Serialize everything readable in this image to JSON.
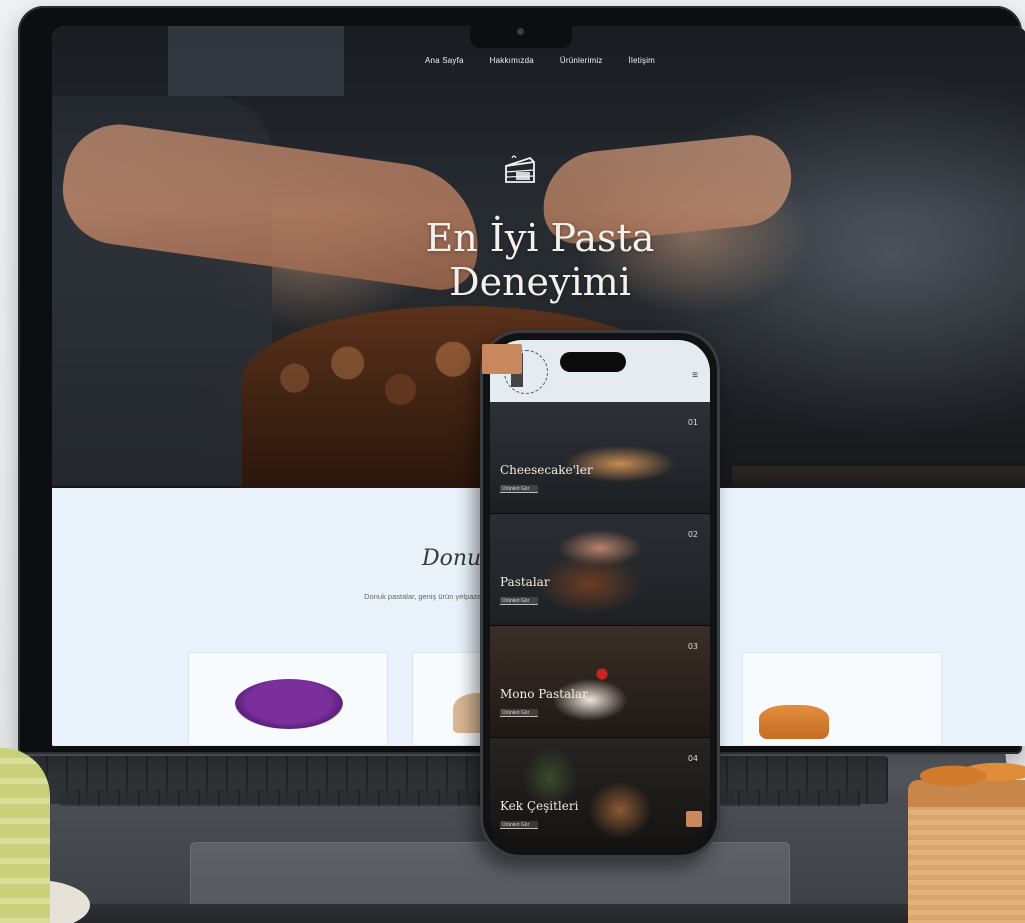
{
  "laptop_site": {
    "nav": [
      "Ana Sayfa",
      "Hakkımızda",
      "Ürünlerimiz",
      "İletişim"
    ],
    "hero_title_line1": "En İyi Pasta",
    "hero_title_line2": "Deneyimi",
    "about_title": "Donukla T",
    "about_text": "Donuk pastalar, geniş ürün yelpazesi. İs... memnuniyetini amaç ve özenle, kalit..."
  },
  "phone_site": {
    "categories": [
      {
        "num": "01",
        "title": "Cheesecake'ler",
        "button": "Ürünleri Gör"
      },
      {
        "num": "02",
        "title": "Pastalar",
        "button": "Ürünleri Gör"
      },
      {
        "num": "03",
        "title": "Mono Pastalar",
        "button": "Ürünleri Gör"
      },
      {
        "num": "04",
        "title": "Kek Çeşitleri",
        "button": "Ürünleri Gör"
      }
    ],
    "menu_icon": "≡"
  },
  "colors": {
    "accent": "#c9875d",
    "about_bg": "#e9f2fa",
    "hero_dark": "#21262c"
  },
  "icons": {
    "cake_logo": "cake-slice-icon",
    "phone_logo": "brand-logo-icon"
  }
}
